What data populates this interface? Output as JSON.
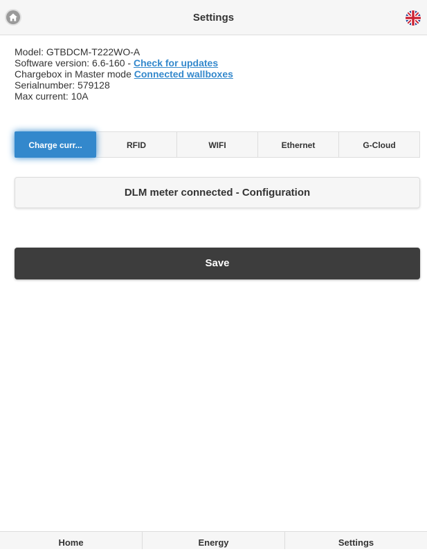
{
  "header": {
    "title": "Settings",
    "home_icon": "home-icon",
    "flag_icon": "uk-flag-icon"
  },
  "info": {
    "model": "Model: GTBDCM-T222WO-A",
    "software_prefix": "Software version: 6.6-160 - ",
    "check_updates_link": "Check for updates",
    "chargebox_prefix": "Chargebox in Master mode ",
    "connected_wallboxes_link": "Connected wallboxes",
    "serialnumber": "Serialnumber: 579128",
    "max_current": "Max current: 10A"
  },
  "tabs": [
    {
      "label": "Charge curr...",
      "active": true
    },
    {
      "label": "RFID",
      "active": false
    },
    {
      "label": "WIFI",
      "active": false
    },
    {
      "label": "Ethernet",
      "active": false
    },
    {
      "label": "G-Cloud",
      "active": false
    }
  ],
  "dlm_button": {
    "label": "DLM meter connected - Configuration"
  },
  "save_button": {
    "label": "Save"
  },
  "footer": {
    "items": [
      {
        "label": "Home"
      },
      {
        "label": "Energy"
      },
      {
        "label": "Settings"
      }
    ]
  },
  "colors": {
    "accent": "#3388cc",
    "save_bg": "#3d3d3d",
    "bar_bg": "#f6f6f6",
    "border": "#dddddd"
  }
}
